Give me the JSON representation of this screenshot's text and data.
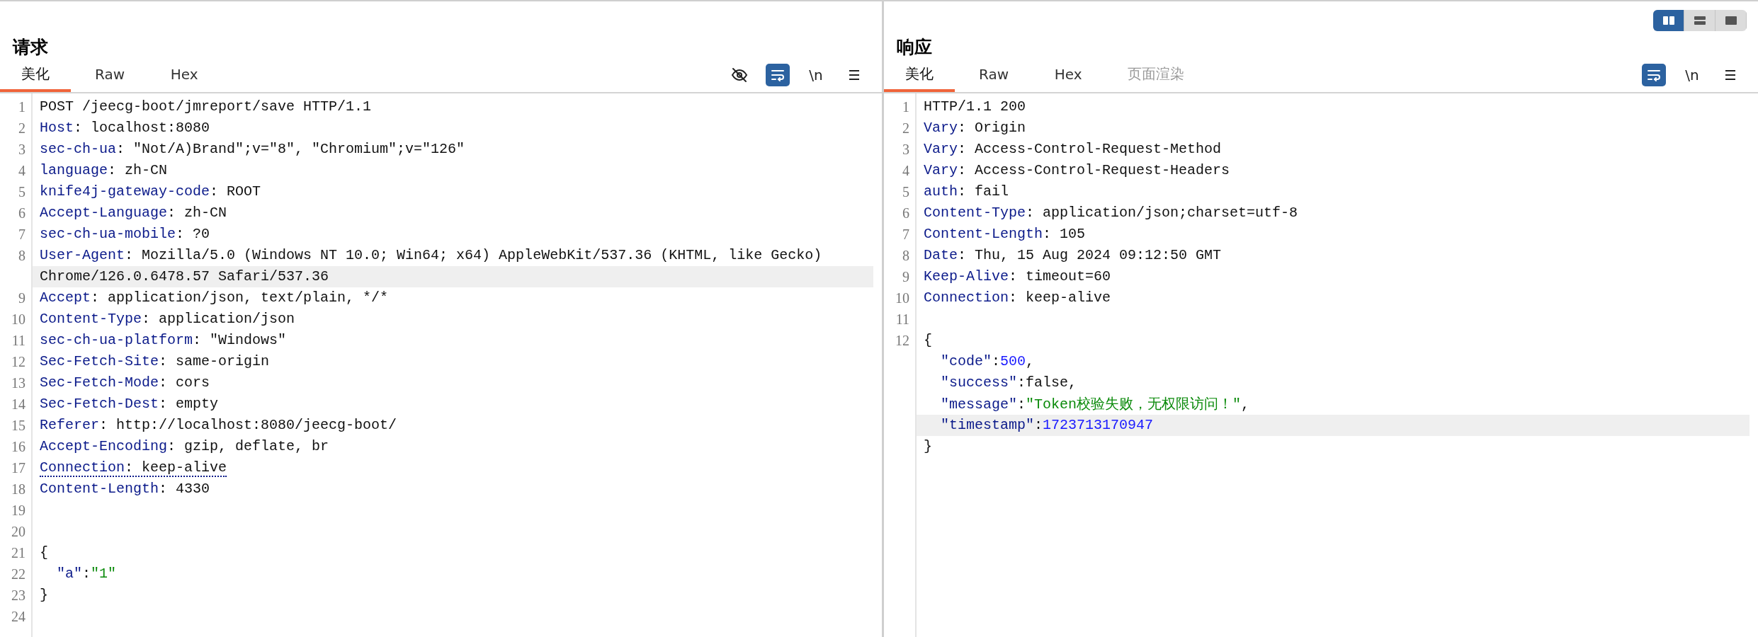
{
  "request": {
    "title": "请求",
    "tabs": [
      {
        "label": "美化",
        "selected": true,
        "disabled": false
      },
      {
        "label": "Raw",
        "selected": false,
        "disabled": false
      },
      {
        "label": "Hex",
        "selected": false,
        "disabled": false
      }
    ],
    "toolbar": [
      {
        "kind": "eye-off",
        "on": false
      },
      {
        "kind": "wrap",
        "on": true
      },
      {
        "kind": "text",
        "label": "\\n",
        "on": false
      },
      {
        "kind": "menu",
        "on": false
      }
    ],
    "lines": [
      {
        "number": "1",
        "highlighted": false,
        "underlined": false,
        "segments": [
          {
            "kind": "text",
            "text": "POST /jeecg-boot/jmreport/save HTTP/1.1"
          }
        ]
      },
      {
        "number": "2",
        "highlighted": false,
        "underlined": false,
        "segments": [
          {
            "kind": "name",
            "text": "Host"
          },
          {
            "kind": "text",
            "text": ": localhost:8080"
          }
        ]
      },
      {
        "number": "3",
        "highlighted": false,
        "underlined": false,
        "segments": [
          {
            "kind": "name",
            "text": "sec-ch-ua"
          },
          {
            "kind": "text",
            "text": ": \"Not/A)Brand\";v=\"8\", \"Chromium\";v=\"126\""
          }
        ]
      },
      {
        "number": "4",
        "highlighted": false,
        "underlined": false,
        "segments": [
          {
            "kind": "name",
            "text": "language"
          },
          {
            "kind": "text",
            "text": ": zh-CN"
          }
        ]
      },
      {
        "number": "5",
        "highlighted": false,
        "underlined": false,
        "segments": [
          {
            "kind": "name",
            "text": "knife4j-gateway-code"
          },
          {
            "kind": "text",
            "text": ": ROOT"
          }
        ]
      },
      {
        "number": "6",
        "highlighted": false,
        "underlined": false,
        "segments": [
          {
            "kind": "name",
            "text": "Accept-Language"
          },
          {
            "kind": "text",
            "text": ": zh-CN"
          }
        ]
      },
      {
        "number": "7",
        "highlighted": false,
        "underlined": false,
        "segments": [
          {
            "kind": "name",
            "text": "sec-ch-ua-mobile"
          },
          {
            "kind": "text",
            "text": ": ?0"
          }
        ]
      },
      {
        "number": "8",
        "highlighted": false,
        "underlined": false,
        "segments": [
          {
            "kind": "name",
            "text": "User-Agent"
          },
          {
            "kind": "text",
            "text": ": Mozilla/5.0 (Windows NT 10.0; Win64; x64) AppleWebKit/537.36 (KHTML, like Gecko)"
          }
        ]
      },
      {
        "highlighted": true,
        "underlined": false,
        "segments": [
          {
            "kind": "text",
            "text": "Chrome/126.0.6478.57 Safari/537.36"
          }
        ]
      },
      {
        "number": "9",
        "highlighted": false,
        "underlined": false,
        "segments": [
          {
            "kind": "name",
            "text": "Accept"
          },
          {
            "kind": "text",
            "text": ": application/json, text/plain, */*"
          }
        ]
      },
      {
        "number": "10",
        "highlighted": false,
        "underlined": false,
        "segments": [
          {
            "kind": "name",
            "text": "Content-Type"
          },
          {
            "kind": "text",
            "text": ": application/json"
          }
        ]
      },
      {
        "number": "11",
        "highlighted": false,
        "underlined": false,
        "segments": [
          {
            "kind": "name",
            "text": "sec-ch-ua-platform"
          },
          {
            "kind": "text",
            "text": ": \"Windows\""
          }
        ]
      },
      {
        "number": "12",
        "highlighted": false,
        "underlined": false,
        "segments": [
          {
            "kind": "name",
            "text": "Sec-Fetch-Site"
          },
          {
            "kind": "text",
            "text": ": same-origin"
          }
        ]
      },
      {
        "number": "13",
        "highlighted": false,
        "underlined": false,
        "segments": [
          {
            "kind": "name",
            "text": "Sec-Fetch-Mode"
          },
          {
            "kind": "text",
            "text": ": cors"
          }
        ]
      },
      {
        "number": "14",
        "highlighted": false,
        "underlined": false,
        "segments": [
          {
            "kind": "name",
            "text": "Sec-Fetch-Dest"
          },
          {
            "kind": "text",
            "text": ": empty"
          }
        ]
      },
      {
        "number": "15",
        "highlighted": false,
        "underlined": false,
        "segments": [
          {
            "kind": "name",
            "text": "Referer"
          },
          {
            "kind": "text",
            "text": ": http://localhost:8080/jeecg-boot/"
          }
        ]
      },
      {
        "number": "16",
        "highlighted": false,
        "underlined": false,
        "segments": [
          {
            "kind": "name",
            "text": "Accept-Encoding"
          },
          {
            "kind": "text",
            "text": ": gzip, deflate, br"
          }
        ]
      },
      {
        "number": "17",
        "highlighted": false,
        "underlined": true,
        "segments": [
          {
            "kind": "name",
            "text": "Connection"
          },
          {
            "kind": "text",
            "text": ": keep-alive"
          }
        ]
      },
      {
        "number": "18",
        "highlighted": false,
        "underlined": false,
        "segments": [
          {
            "kind": "name",
            "text": "Content-Length"
          },
          {
            "kind": "text",
            "text": ": 4330"
          }
        ]
      },
      {
        "number": "19",
        "highlighted": false
      },
      {
        "number": "20",
        "highlighted": false
      },
      {
        "number": "21",
        "highlighted": false,
        "underlined": false,
        "segments": [
          {
            "kind": "text",
            "text": "{"
          }
        ]
      },
      {
        "number": "22",
        "highlighted": false,
        "underlined": false,
        "segments": [
          {
            "kind": "key",
            "text": "  \"a\""
          },
          {
            "kind": "text",
            "text": ":"
          },
          {
            "kind": "string",
            "text": "\"1\""
          }
        ]
      },
      {
        "number": "23",
        "highlighted": false,
        "underlined": false,
        "segments": [
          {
            "kind": "text",
            "text": "}"
          }
        ]
      },
      {
        "number": "24",
        "highlighted": false
      }
    ]
  },
  "view_modes": [
    {
      "kind": "columns",
      "selected": true
    },
    {
      "kind": "rows",
      "selected": false
    },
    {
      "kind": "single",
      "selected": false
    }
  ],
  "response": {
    "title": "响应",
    "tabs": [
      {
        "label": "美化",
        "selected": true,
        "disabled": false
      },
      {
        "label": "Raw",
        "selected": false,
        "disabled": false
      },
      {
        "label": "Hex",
        "selected": false,
        "disabled": false
      },
      {
        "label": "页面渲染",
        "selected": false,
        "disabled": true
      }
    ],
    "toolbar": [
      {
        "kind": "wrap",
        "on": true
      },
      {
        "kind": "text",
        "label": "\\n",
        "on": false
      },
      {
        "kind": "menu",
        "on": false
      }
    ],
    "lines": [
      {
        "number": "1",
        "highlighted": false,
        "underlined": false,
        "segments": [
          {
            "kind": "text",
            "text": "HTTP/1.1 200"
          }
        ]
      },
      {
        "number": "2",
        "highlighted": false,
        "underlined": false,
        "segments": [
          {
            "kind": "name",
            "text": "Vary"
          },
          {
            "kind": "text",
            "text": ": Origin"
          }
        ]
      },
      {
        "number": "3",
        "highlighted": false,
        "underlined": false,
        "segments": [
          {
            "kind": "name",
            "text": "Vary"
          },
          {
            "kind": "text",
            "text": ": Access-Control-Request-Method"
          }
        ]
      },
      {
        "number": "4",
        "highlighted": false,
        "underlined": false,
        "segments": [
          {
            "kind": "name",
            "text": "Vary"
          },
          {
            "kind": "text",
            "text": ": Access-Control-Request-Headers"
          }
        ]
      },
      {
        "number": "5",
        "highlighted": false,
        "underlined": false,
        "segments": [
          {
            "kind": "name",
            "text": "auth"
          },
          {
            "kind": "text",
            "text": ": fail"
          }
        ]
      },
      {
        "number": "6",
        "highlighted": false,
        "underlined": false,
        "segments": [
          {
            "kind": "name",
            "text": "Content-Type"
          },
          {
            "kind": "text",
            "text": ": application/json;charset=utf-8"
          }
        ]
      },
      {
        "number": "7",
        "highlighted": false,
        "underlined": false,
        "segments": [
          {
            "kind": "name",
            "text": "Content-Length"
          },
          {
            "kind": "text",
            "text": ": 105"
          }
        ]
      },
      {
        "number": "8",
        "highlighted": false,
        "underlined": false,
        "segments": [
          {
            "kind": "name",
            "text": "Date"
          },
          {
            "kind": "text",
            "text": ": Thu, 15 Aug 2024 09:12:50 GMT"
          }
        ]
      },
      {
        "number": "9",
        "highlighted": false,
        "underlined": false,
        "segments": [
          {
            "kind": "name",
            "text": "Keep-Alive"
          },
          {
            "kind": "text",
            "text": ": timeout=60"
          }
        ]
      },
      {
        "number": "10",
        "highlighted": false,
        "underlined": false,
        "segments": [
          {
            "kind": "name",
            "text": "Connection"
          },
          {
            "kind": "text",
            "text": ": keep-alive"
          }
        ]
      },
      {
        "number": "11",
        "highlighted": false
      },
      {
        "number": "12",
        "highlighted": false,
        "underlined": false,
        "segments": [
          {
            "kind": "text",
            "text": "{"
          }
        ]
      },
      {
        "highlighted": false,
        "underlined": false,
        "segments": [
          {
            "kind": "key",
            "text": "  \"code\""
          },
          {
            "kind": "text",
            "text": ":"
          },
          {
            "kind": "number",
            "text": "500"
          },
          {
            "kind": "text",
            "text": ","
          }
        ]
      },
      {
        "highlighted": false,
        "underlined": false,
        "segments": [
          {
            "kind": "key",
            "text": "  \"success\""
          },
          {
            "kind": "text",
            "text": ":false,"
          }
        ]
      },
      {
        "highlighted": false,
        "underlined": false,
        "segments": [
          {
            "kind": "key",
            "text": "  \"message\""
          },
          {
            "kind": "text",
            "text": ":"
          },
          {
            "kind": "string",
            "text": "\"Token校验失败，无权限访问！\""
          },
          {
            "kind": "text",
            "text": ","
          }
        ]
      },
      {
        "highlighted": true,
        "underlined": false,
        "segments": [
          {
            "kind": "key",
            "text": "  \"timestamp\""
          },
          {
            "kind": "text",
            "text": ":"
          },
          {
            "kind": "number",
            "text": "1723713170947"
          }
        ]
      },
      {
        "highlighted": false,
        "underlined": false,
        "segments": [
          {
            "kind": "text",
            "text": "}"
          }
        ]
      }
    ]
  }
}
